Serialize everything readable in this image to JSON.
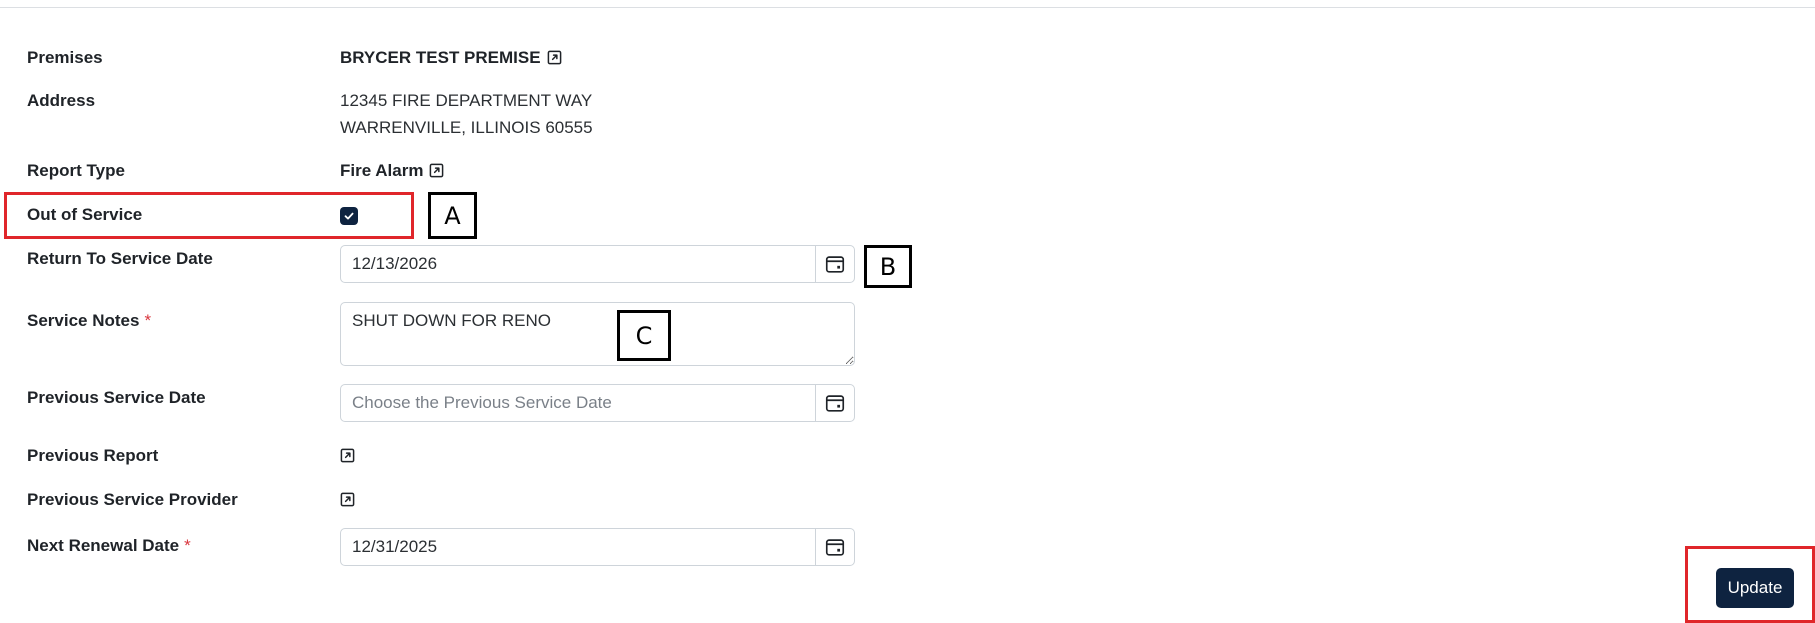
{
  "form": {
    "premises": {
      "label": "Premises",
      "value": "BRYCER TEST PREMISE"
    },
    "address": {
      "label": "Address",
      "line1": "12345 FIRE DEPARTMENT WAY",
      "line2": "WARRENVILLE, ILLINOIS 60555"
    },
    "report_type": {
      "label": "Report Type",
      "value": "Fire Alarm"
    },
    "out_of_service": {
      "label": "Out of Service",
      "checked": true
    },
    "return_to_service_date": {
      "label": "Return To Service Date",
      "value": "12/13/2026"
    },
    "service_notes": {
      "label": "Service Notes",
      "required_mark": "*",
      "value": "SHUT DOWN FOR RENO"
    },
    "previous_service_date": {
      "label": "Previous Service Date",
      "value": "",
      "placeholder": "Choose the Previous Service Date"
    },
    "previous_report": {
      "label": "Previous Report"
    },
    "previous_service_provider": {
      "label": "Previous Service Provider"
    },
    "next_renewal_date": {
      "label": "Next Renewal Date",
      "required_mark": "*",
      "value": "12/31/2025"
    }
  },
  "actions": {
    "update_label": "Update"
  },
  "annotations": {
    "a": "A",
    "b": "B",
    "c": "C"
  },
  "colors": {
    "primary_button": "#0e2340",
    "checkbox": "#0e2340",
    "required_mark": "#d9363e",
    "highlight_box": "#e0262a",
    "annotation_box": "#000000"
  },
  "icons": {
    "external_link": "external-link-icon",
    "calendar": "calendar-icon",
    "checkmark": "check-icon"
  }
}
